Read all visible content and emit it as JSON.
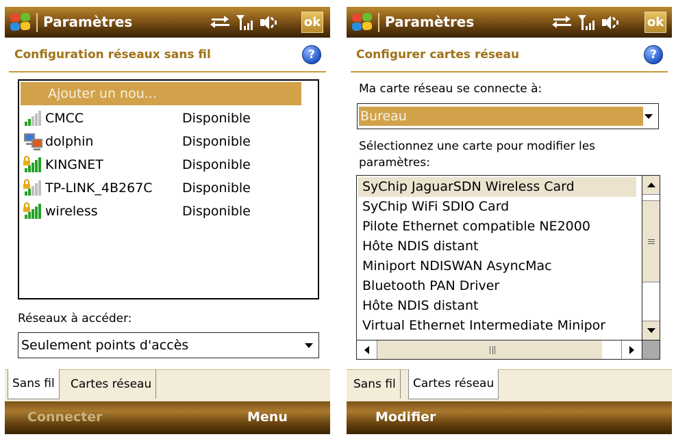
{
  "left": {
    "app_title": "Paramètres",
    "ok_label": "ok",
    "heading": "Configuration réseaux sans fil",
    "help_label": "?",
    "add_network": "Ajouter un nou...",
    "networks": [
      {
        "name": "CMCC",
        "status": "Disponible",
        "signal": "weak-open"
      },
      {
        "name": "dolphin",
        "status": "Disponible",
        "signal": "adhoc"
      },
      {
        "name": "KINGNET",
        "status": "Disponible",
        "signal": "strong-secured"
      },
      {
        "name": "TP-LINK_4B267C",
        "status": "Disponible",
        "signal": "weak-secured"
      },
      {
        "name": "wireless",
        "status": "Disponible",
        "signal": "strong-secured"
      }
    ],
    "access_label": "Réseaux à accéder:",
    "access_value": "Seulement points d'accès",
    "tabs": [
      "Sans fil",
      "Cartes réseau"
    ],
    "active_tab": 0,
    "softkey_left": "Connecter",
    "softkey_right": "Menu"
  },
  "right": {
    "app_title": "Paramètres",
    "ok_label": "ok",
    "heading": "Configurer cartes réseau",
    "help_label": "?",
    "connects_label": "Ma carte réseau se connecte à:",
    "connects_value": "Bureau",
    "select_card_label_1": "Sélectionnez une carte pour modifier les",
    "select_card_label_2": "paramètres:",
    "cards": [
      "SyChip JaguarSDN Wireless Card",
      "SyChip WiFi SDIO Card",
      "Pilote Ethernet compatible NE2000",
      "Hôte NDIS distant",
      "Miniport NDISWAN AsyncMac",
      "Bluetooth PAN Driver",
      "Hôte NDIS distant",
      "Virtual Ethernet Intermediate Minipor"
    ],
    "tabs": [
      "Sans fil",
      "Cartes réseau"
    ],
    "active_tab": 1,
    "softkey_left": "Modifier"
  },
  "colors": {
    "accent_gold": "#d2a24a",
    "heading_gold": "#a07117",
    "titlebar_brown": "#8e5f1b",
    "signal_green": "#27a127",
    "lock_yellow": "#e8ad17"
  },
  "icons": [
    "windows-start-icon",
    "connectivity-icon",
    "signal-icon",
    "volume-icon",
    "help-icon",
    "wifi-signal-icon",
    "lock-icon",
    "adhoc-computer-icon",
    "dropdown-arrow-icon"
  ]
}
